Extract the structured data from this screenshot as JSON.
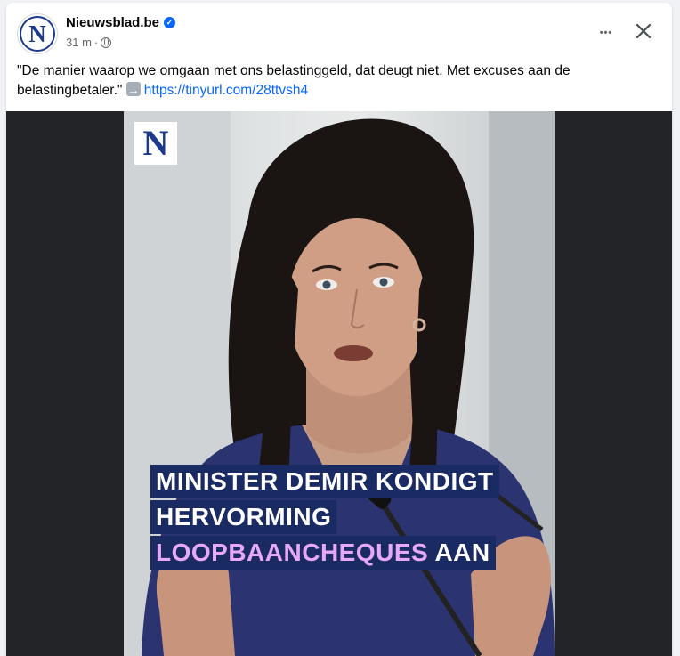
{
  "post": {
    "page_name": "Nieuwsblad.be",
    "avatar_letter": "N",
    "verified_mark": "✓",
    "time": "31 m",
    "separator": "·",
    "text_before": "\"De manier waarop we omgaan met ons belastinggeld, dat deugt niet. Met excuses aan de belastingbetaler.\"",
    "link": "https://tinyurl.com/28ttvsh4",
    "more_label": "•••"
  },
  "media": {
    "logo_letter": "N",
    "headline_line1": "MINISTER DEMIR KONDIGT",
    "headline_line2": "HERVORMING",
    "headline_line3_accent": "LOOPBAANCHEQUES",
    "headline_line3_rest": "AAN"
  },
  "colors": {
    "link": "#0866ff",
    "verified": "#0866ff",
    "headline_bg": "#1a2b63",
    "headline_accent": "#e7a8f7",
    "brand": "#1b3a8c"
  },
  "icons": {
    "verified": "verified-badge-icon",
    "privacy": "globe-icon",
    "more": "more-options-icon",
    "close": "close-icon",
    "arrow": "right-arrow-emoji-icon"
  }
}
